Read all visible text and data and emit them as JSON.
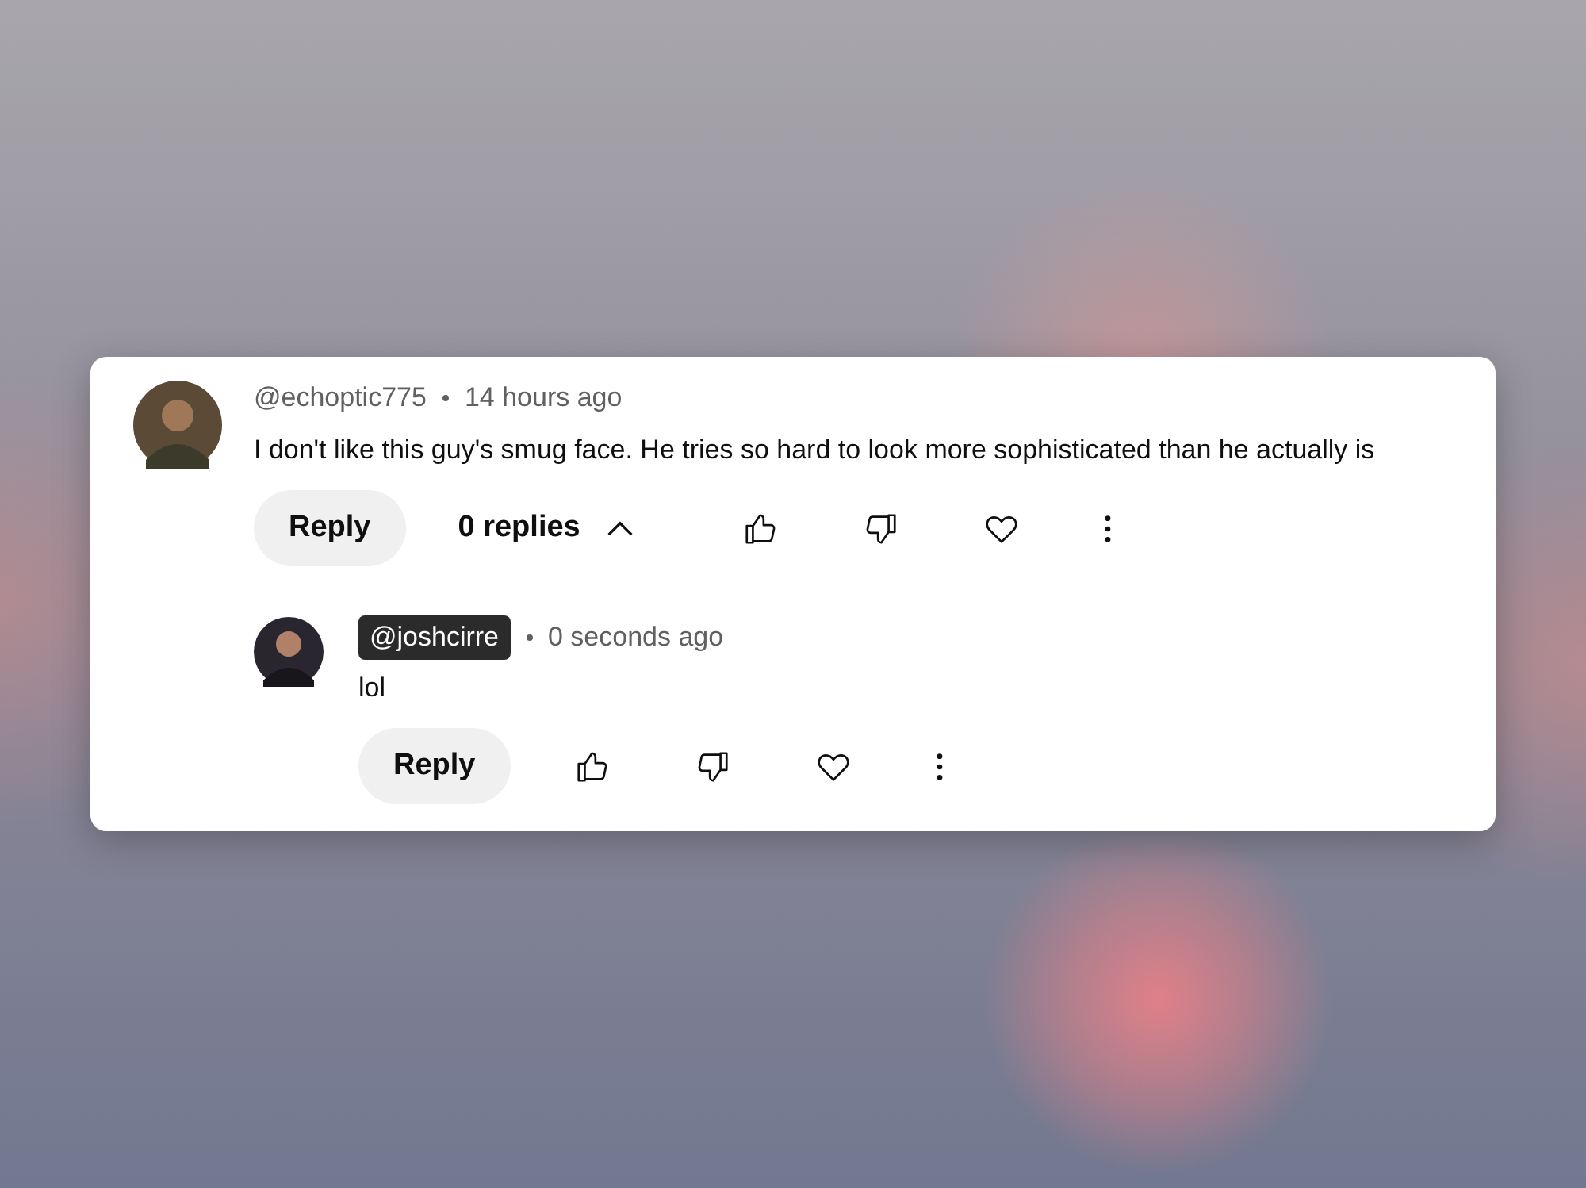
{
  "comment": {
    "author": "@echoptic775",
    "author_highlighted": false,
    "time": "14 hours ago",
    "text": "I don't like this guy's smug face. He tries so hard to look more sophisticated than he actually is",
    "reply_button": "Reply",
    "replies_toggle": {
      "label": "0 replies",
      "expanded": true
    }
  },
  "replies": [
    {
      "author": "@joshcirre",
      "author_highlighted": true,
      "time": "0 seconds ago",
      "text": "lol",
      "reply_button": "Reply"
    }
  ]
}
